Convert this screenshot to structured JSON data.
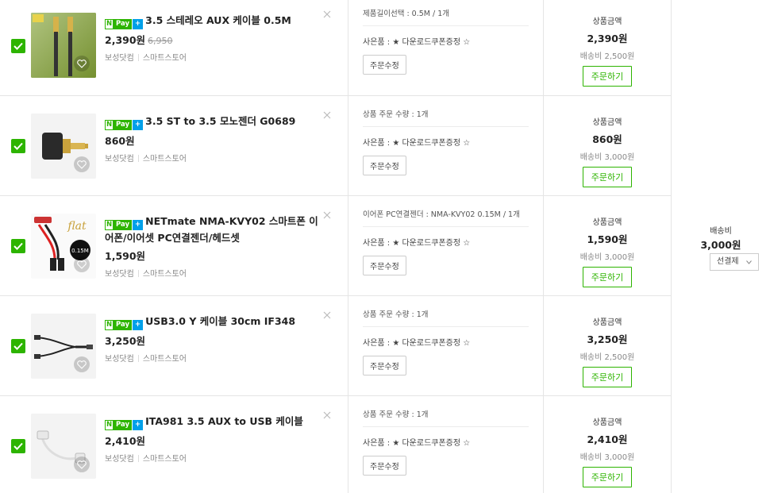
{
  "labels": {
    "product_amount": "상품금액",
    "edit_order": "주문수정",
    "buy_now": "주문하기",
    "shipping_fee": "배송비",
    "gift_prefix": "사은품 : ",
    "gift_text": "★ 다운로드쿠폰증정 ☆"
  },
  "colors": {
    "accent": "#2db400",
    "npay_plus": "#00a0e9"
  },
  "npay": {
    "n": "N",
    "pay": "Pay",
    "plus": "+"
  },
  "items": [
    {
      "checked": true,
      "icon": "aux-cable-gold-image",
      "title": "3.5 스테레오 AUX 케이블 0.5M",
      "price": "2,390원",
      "original_price": "6,950",
      "seller": "보성닷컴",
      "store": "스마트스토어",
      "option": "제품길이선택 : 0.5M / 1개",
      "amount": "2,390원",
      "shipping": "배송비 2,500원"
    },
    {
      "checked": true,
      "icon": "mono-gender-plug-image",
      "title": "3.5 ST to 3.5 모노젠더 G0689",
      "price": "860원",
      "original_price": "",
      "seller": "보성닷컴",
      "store": "스마트스토어",
      "option": "상품 주문 수량 : 1개",
      "amount": "860원",
      "shipping": "배송비 3,000원"
    },
    {
      "checked": true,
      "icon": "splitter-cable-image",
      "title": "NETmate NMA-KVY02 스마트폰 이어폰/이어셋 PC연결젠더/헤드셋",
      "price": "1,590원",
      "original_price": "",
      "seller": "보성닷컴",
      "store": "스마트스토어",
      "option": "이어폰 PC연결젠더 : NMA-KVY02 0.15M / 1개",
      "amount": "1,590원",
      "shipping": "배송비 3,000원",
      "thumb_badge": "0.15M",
      "thumb_brand": "flat"
    },
    {
      "checked": true,
      "icon": "y-cable-image",
      "title": "USB3.0 Y 케이블 30cm IF348",
      "price": "3,250원",
      "original_price": "",
      "seller": "보성닷컴",
      "store": "스마트스토어",
      "option": "상품 주문 수량 : 1개",
      "amount": "3,250원",
      "shipping": "배송비 2,500원"
    },
    {
      "checked": true,
      "icon": "aux-usb-cable-image",
      "title": "ITA981 3.5 AUX to USB 케이블",
      "price": "2,410원",
      "original_price": "",
      "seller": "보성닷컴",
      "store": "스마트스토어",
      "option": "상품 주문 수량 : 1개",
      "amount": "2,410원",
      "shipping": "배송비 3,000원"
    }
  ],
  "shipping_summary": {
    "label": "배송비",
    "value": "3,000원",
    "select": "선결제"
  }
}
